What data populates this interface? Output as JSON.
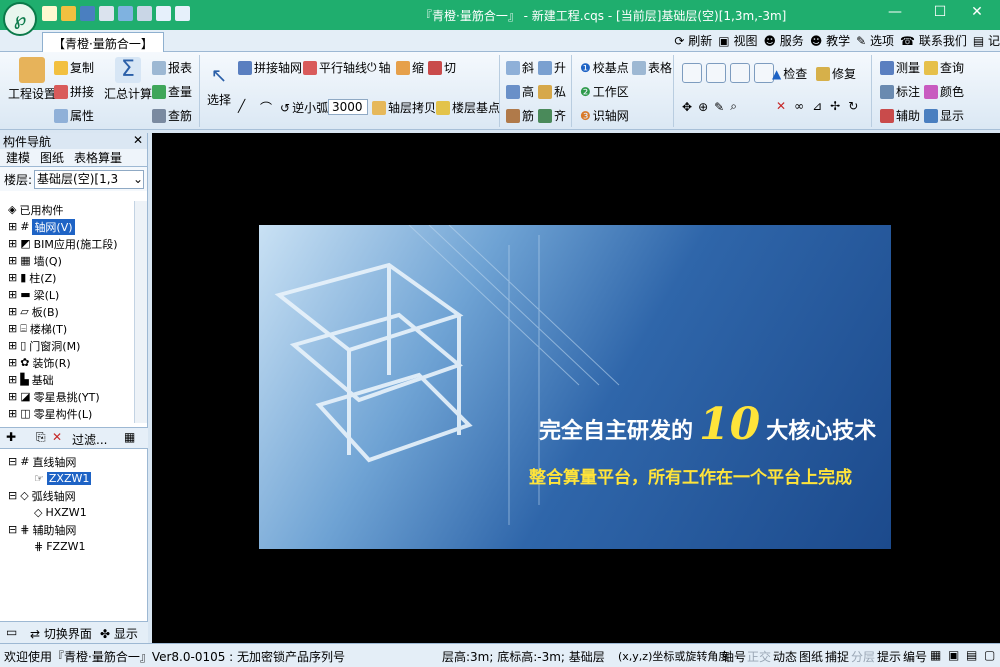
{
  "window": {
    "title": "『青橙·量筋合一』 - 新建工程.cqs - [当前层]基础层(空)[1,3m,-3m]",
    "logo_text": "℘",
    "app_tab": "【青橙·量筋合一】"
  },
  "topbar": [
    "服务",
    "教学",
    "选项",
    "联系我们",
    "记"
  ],
  "ribbon": {
    "project_settings": "工程设置",
    "copy": "复制",
    "splice": "拼接",
    "attributes": "属性",
    "summary_calc": "汇总计算",
    "report": "报表",
    "check_qty": "查量",
    "check_rebar": "查筋",
    "select": "选择",
    "splice_axis": "拼接轴网",
    "parallel_axis": "平行轴线",
    "axis": "轴",
    "shrink": "缩",
    "cut": "切",
    "reverse_arc": "逆小弧",
    "arc_value": "3000",
    "floor_copy": "轴层拷贝",
    "floor_base": "楼层基点",
    "slope": "斜",
    "raise": "升",
    "height": "高",
    "private": "私",
    "rebar": "筋",
    "align": "齐",
    "check_base": "校基点",
    "table": "表格",
    "work_area": "工作区",
    "identify_axis": "识轴网",
    "inspect": "检查",
    "repair": "修复",
    "measure": "测量",
    "query": "查询",
    "annotate": "标注",
    "color": "颜色",
    "auxiliary": "辅助",
    "display": "显示",
    "refresh": "刷新",
    "view": "视图"
  },
  "nav": {
    "header": "构件导航",
    "tabs": [
      "建模",
      "图纸",
      "表格算量"
    ],
    "floor_label": "楼层:",
    "floor_value": "基础层(空)[1,3",
    "tree": [
      "已用构件",
      "轴网(V)",
      "BIM应用(施工段)",
      "墙(Q)",
      "柱(Z)",
      "梁(L)",
      "板(B)",
      "楼梯(T)",
      "门窗洞(M)",
      "装饰(R)",
      "基础",
      "零星悬挑(YT)",
      "零星构件(L)"
    ],
    "filter": "过滤...",
    "tree2": [
      {
        "label": "直线轴网",
        "child": "ZXZW1"
      },
      {
        "label": "弧线轴网",
        "child": "HXZW1"
      },
      {
        "label": "辅助轴网",
        "child": "FZZW1"
      }
    ],
    "switch_ui": "切换界面",
    "display": "显示"
  },
  "banner": {
    "line1_pre": "完全自主研发的",
    "line1_num": "10",
    "line1_post": "大核心技术",
    "line2": "整合算量平台，所有工作在一个平台上完成"
  },
  "status": {
    "welcome": "欢迎使用『青橙·量筋合一』Ver8.0-0105 : 无加密锁产品序列号",
    "floor": "层高:3m; 底标高:-3m; 基础层",
    "coords": "(x,y,z)坐标或旋转角度",
    "items": [
      "轴号",
      "正交",
      "动态",
      "图纸",
      "捕捉",
      "分层",
      "提示",
      "编号"
    ]
  },
  "colors": {
    "titlebar": "#1fae6e",
    "canvas": "#000000",
    "selection": "#1e63c5",
    "banner_yellow": "#ffe43a"
  }
}
